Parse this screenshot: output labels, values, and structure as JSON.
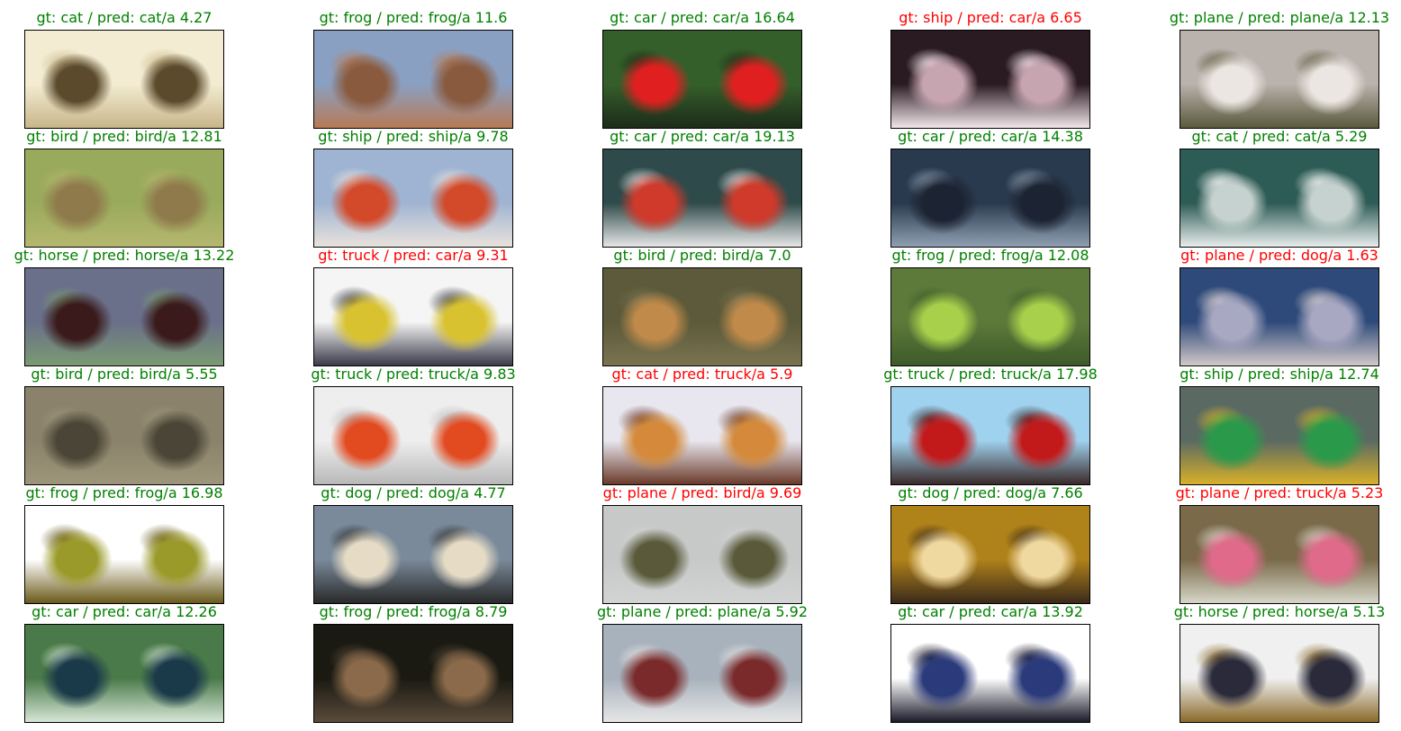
{
  "panels": [
    {
      "title": "gt: cat / pred: cat/a 4.27",
      "correct": true,
      "thumbnail": "cat-photo",
      "palette": [
        "#f3ecd2",
        "#5b4a2c",
        "#c9b68a"
      ]
    },
    {
      "title": "gt: frog / pred: frog/a 11.6",
      "correct": true,
      "thumbnail": "frog-photo",
      "palette": [
        "#8aa0c2",
        "#8a5a3e",
        "#b77a55"
      ]
    },
    {
      "title": "gt: car / pred: car/a 16.64",
      "correct": true,
      "thumbnail": "car-photo",
      "palette": [
        "#355f2a",
        "#e02020",
        "#1d2b1a"
      ]
    },
    {
      "title": "gt: ship / pred: car/a 6.65",
      "correct": false,
      "thumbnail": "ship-photo",
      "palette": [
        "#2a1a22",
        "#c7a5b0",
        "#f2e6ea"
      ]
    },
    {
      "title": "gt: plane / pred: plane/a 12.13",
      "correct": true,
      "thumbnail": "plane-photo",
      "palette": [
        "#b9b2ad",
        "#ece6e2",
        "#5a5a3c"
      ]
    },
    {
      "title": "gt: bird / pred: bird/a 12.81",
      "correct": true,
      "thumbnail": "bird-photo",
      "palette": [
        "#9aaa5c",
        "#8f7a4c",
        "#b5b76f"
      ]
    },
    {
      "title": "gt: ship / pred: ship/a 9.78",
      "correct": true,
      "thumbnail": "ship-photo",
      "palette": [
        "#9fb4d2",
        "#d24a2a",
        "#e9e2dc"
      ]
    },
    {
      "title": "gt: car / pred: car/a 19.13",
      "correct": true,
      "thumbnail": "car-photo",
      "palette": [
        "#2f4a4a",
        "#cf3a2a",
        "#e6e6e6"
      ]
    },
    {
      "title": "gt: car / pred: car/a 14.38",
      "correct": true,
      "thumbnail": "car-photo",
      "palette": [
        "#2a3a4e",
        "#1c2433",
        "#8fa0b2"
      ]
    },
    {
      "title": "gt: cat / pred: cat/a 5.29",
      "correct": true,
      "thumbnail": "cat-photo",
      "palette": [
        "#2d5b55",
        "#c6d2cf",
        "#e8eeec"
      ]
    },
    {
      "title": "gt: horse / pred: horse/a 13.22",
      "correct": true,
      "thumbnail": "horse-photo",
      "palette": [
        "#6a6f8a",
        "#3a1a1a",
        "#7a9a72"
      ]
    },
    {
      "title": "gt: truck / pred: car/a 9.31",
      "correct": false,
      "thumbnail": "truck-photo",
      "palette": [
        "#f5f5f5",
        "#d9c230",
        "#3a3a4a"
      ]
    },
    {
      "title": "gt: bird / pred: bird/a 7.0",
      "correct": true,
      "thumbnail": "bird-photo",
      "palette": [
        "#5c5a3a",
        "#c08a4a",
        "#7a7350"
      ]
    },
    {
      "title": "gt: frog / pred: frog/a 12.08",
      "correct": true,
      "thumbnail": "frog-photo",
      "palette": [
        "#5e7a3a",
        "#a8d04a",
        "#3d5a2a"
      ]
    },
    {
      "title": "gt: plane / pred: dog/a 1.63",
      "correct": false,
      "thumbnail": "plane-photo",
      "palette": [
        "#2e4a7a",
        "#a8a8c2",
        "#d2c8c8"
      ]
    },
    {
      "title": "gt: bird / pred: bird/a 5.55",
      "correct": true,
      "thumbnail": "bird-photo",
      "palette": [
        "#8a826a",
        "#4a4536",
        "#9e967a"
      ]
    },
    {
      "title": "gt: truck / pred: truck/a 9.83",
      "correct": true,
      "thumbnail": "truck-photo",
      "palette": [
        "#eeeeee",
        "#e24a20",
        "#b8b8b8"
      ]
    },
    {
      "title": "gt: cat / pred: truck/a 5.9",
      "correct": false,
      "thumbnail": "cat-photo",
      "palette": [
        "#e8e6ee",
        "#d48a3a",
        "#6a3a2a"
      ]
    },
    {
      "title": "gt: truck / pred: truck/a 17.98",
      "correct": true,
      "thumbnail": "truck-photo",
      "palette": [
        "#9fd2ee",
        "#c21a1a",
        "#3a2a2a"
      ]
    },
    {
      "title": "gt: ship / pred: ship/a 12.74",
      "correct": true,
      "thumbnail": "ship-photo",
      "palette": [
        "#5a6a62",
        "#2a9a4a",
        "#d8b02a"
      ]
    },
    {
      "title": "gt: frog / pred: frog/a 16.98",
      "correct": true,
      "thumbnail": "frog-photo",
      "palette": [
        "#ffffff",
        "#9a9a2a",
        "#6a5a1a"
      ]
    },
    {
      "title": "gt: dog / pred: dog/a 4.77",
      "correct": true,
      "thumbnail": "dog-photo",
      "palette": [
        "#7a8a9a",
        "#e6dcc6",
        "#2a2a2a"
      ]
    },
    {
      "title": "gt: plane / pred: bird/a 9.69",
      "correct": false,
      "thumbnail": "plane-photo",
      "palette": [
        "#c6c9c8",
        "#5a5a3a",
        "#d2d4d3"
      ]
    },
    {
      "title": "gt: dog / pred: dog/a 7.66",
      "correct": true,
      "thumbnail": "dog-photo",
      "palette": [
        "#b0821a",
        "#f0d9a0",
        "#3a2a1a"
      ]
    },
    {
      "title": "gt: plane / pred: truck/a 5.23",
      "correct": false,
      "thumbnail": "plane-photo",
      "palette": [
        "#7a6a4a",
        "#e06a8a",
        "#d6d6c8"
      ]
    },
    {
      "title": "gt: car / pred: car/a 12.26",
      "correct": true,
      "thumbnail": "car-photo",
      "palette": [
        "#4a7a4a",
        "#1a3a4a",
        "#d6e6d6"
      ]
    },
    {
      "title": "gt: frog / pred: frog/a 8.79",
      "correct": true,
      "thumbnail": "frog-photo",
      "palette": [
        "#1a1a12",
        "#8a6a4a",
        "#5a4a3a"
      ]
    },
    {
      "title": "gt: plane / pred: plane/a 5.92",
      "correct": true,
      "thumbnail": "plane-photo",
      "palette": [
        "#a8b2bc",
        "#7a2a2a",
        "#e6e6e6"
      ]
    },
    {
      "title": "gt: car / pred: car/a 13.92",
      "correct": true,
      "thumbnail": "car-photo",
      "palette": [
        "#ffffff",
        "#2a3a7a",
        "#1a1a2a"
      ]
    },
    {
      "title": "gt: horse / pred: horse/a 5.13",
      "correct": true,
      "thumbnail": "horse-photo",
      "palette": [
        "#f0f0f0",
        "#2a2a3a",
        "#8a6a2a"
      ]
    }
  ],
  "colors": {
    "correct": "#008000",
    "wrong": "#ff0000"
  }
}
